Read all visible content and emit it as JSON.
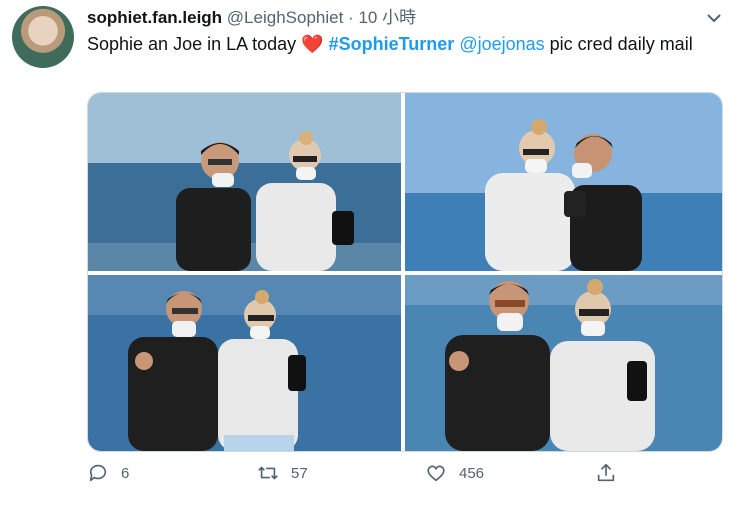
{
  "tweet": {
    "display_name": "sophiet.fan.leigh",
    "handle": "@LeighSophiet",
    "separator": "·",
    "time": "10 小時",
    "text": {
      "part1": "Sophie an Joe in LA today ",
      "heart": "❤️",
      "hashtag": "#SophieTurner",
      "mention": "@joejonas",
      "part2": " pic cred daily mail"
    }
  },
  "media": {
    "photos": [
      "beach-photo-1",
      "beach-photo-2",
      "beach-photo-3",
      "beach-photo-4"
    ]
  },
  "actions": {
    "replies": "6",
    "retweets": "57",
    "likes": "456"
  },
  "colors": {
    "link": "#1d9bf0",
    "muted": "#536471",
    "heart": "#e0245e"
  }
}
